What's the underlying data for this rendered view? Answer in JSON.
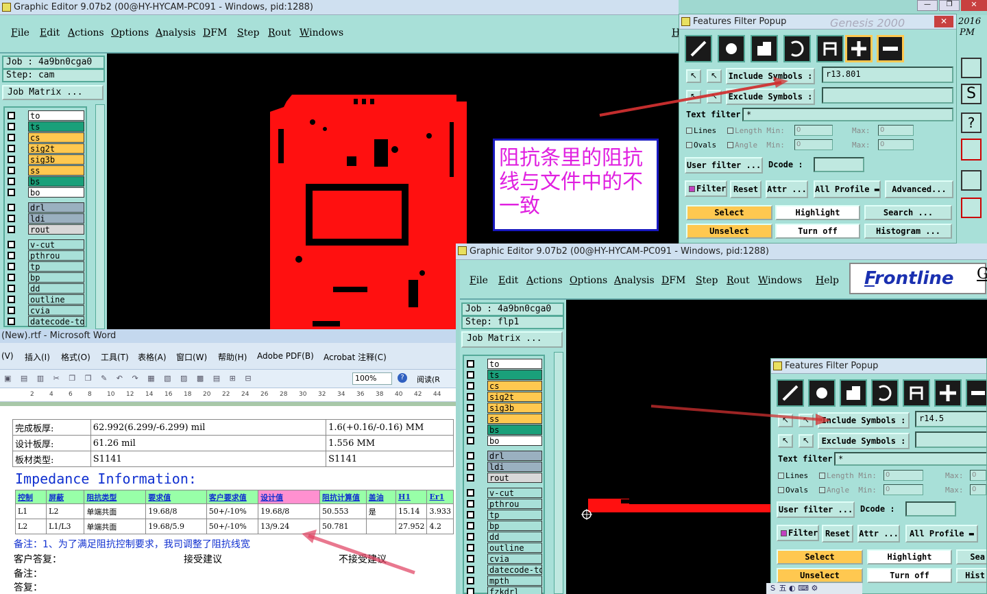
{
  "win1": {
    "title": "Graphic Editor 9.07b2 (00@HY-HYCAM-PC091 - Windows, pid:1288)",
    "menu": [
      "File",
      "Edit",
      "Actions",
      "Options",
      "Analysis",
      "DFM",
      "Step",
      "Rout",
      "Windows"
    ],
    "menu_help_stub": "H",
    "job": "Job : 4a9bn0cga0",
    "step": "Step: cam",
    "job_matrix": "Job Matrix ...",
    "layers": [
      {
        "name": "to",
        "color": "#ffffff"
      },
      {
        "name": "ts",
        "color": "#1aa07a"
      },
      {
        "name": "cs",
        "color": "#ffc850"
      },
      {
        "name": "sig2t",
        "color": "#ffc850"
      },
      {
        "name": "sig3b",
        "color": "#ffc850"
      },
      {
        "name": "ss",
        "color": "#ffc850"
      },
      {
        "name": "bs",
        "color": "#1aa07a"
      },
      {
        "name": "bo",
        "color": "#ffffff"
      },
      {
        "name": "drl",
        "color": "#9ab0c0"
      },
      {
        "name": "ldi",
        "color": "#9ab0c0"
      },
      {
        "name": "rout",
        "color": "#d8d8d8"
      },
      {
        "name": "v-cut",
        "color": "#a8e0d8"
      },
      {
        "name": "pthrou",
        "color": "#a8e0d8"
      },
      {
        "name": "tp",
        "color": "#a8e0d8"
      },
      {
        "name": "bp",
        "color": "#a8e0d8"
      },
      {
        "name": "dd",
        "color": "#a8e0d8"
      },
      {
        "name": "outline",
        "color": "#a8e0d8"
      },
      {
        "name": "cvia",
        "color": "#a8e0d8"
      },
      {
        "name": "datecode-to",
        "color": "#a8e0d8"
      }
    ],
    "annotation": "阻抗条里的阻抗线与文件中的不一致",
    "side_text": [
      "2016",
      "PM"
    ]
  },
  "popup1": {
    "title": "Features Filter Popup",
    "watermark": "Genesis 2000",
    "include_label": "Include Symbols :",
    "include_value": "r13.801",
    "exclude_label": "Exclude Symbols :",
    "exclude_value": "",
    "text_filter_label": "Text filter",
    "text_filter_value": "*",
    "lines": "Lines",
    "ovals": "Ovals",
    "length": "Length",
    "angle": "Angle",
    "min": "Min:",
    "max": "Max:",
    "zero": "0",
    "user_filter": "User filter ...",
    "dcode": "Dcode :",
    "filter": "Filter",
    "reset": "Reset",
    "attr": "Attr ...",
    "all_profile": "All Profile",
    "advanced": "Advanced...",
    "select": "Select",
    "highlight": "Highlight",
    "search": "Search ...",
    "unselect": "Unselect",
    "turn_off": "Turn off",
    "histogram": "Histogram ..."
  },
  "word": {
    "title": "(New).rtf - Microsoft Word",
    "menu": [
      "(V)",
      "插入(I)",
      "格式(O)",
      "工具(T)",
      "表格(A)",
      "窗口(W)",
      "帮助(H)",
      "Adobe PDF(B)",
      "Acrobat 注释(C)"
    ],
    "zoom": "100%",
    "read": "阅读(R",
    "ruler": [
      "2",
      "4",
      "6",
      "8",
      "10",
      "12",
      "14",
      "16",
      "18",
      "20",
      "22",
      "24",
      "26",
      "28",
      "30",
      "32",
      "34",
      "36",
      "38",
      "40",
      "42",
      "44"
    ],
    "info_rows": [
      [
        "完成板厚:",
        "62.992(6.299/-6.299) mil",
        "1.6(+0.16/-0.16) MM"
      ],
      [
        "设计板厚:",
        "61.26 mil",
        "1.556 MM"
      ],
      [
        "板材类型:",
        "S1141",
        "S1141"
      ]
    ],
    "impedance_title": "Impedance Information:",
    "imp_headers": [
      "控制",
      "屏蔽",
      "阻抗类型",
      "要求值",
      "客户要求值",
      "设计值",
      "阻抗计算值",
      "盖油",
      "H1",
      "Er1"
    ],
    "imp_rows": [
      [
        "L1",
        "L2",
        "单端共面",
        "19.68/8",
        "50+/-10%",
        "19.68/8",
        "50.553",
        "是",
        "15.14",
        "3.933"
      ],
      [
        "L2",
        "L1/L3",
        "单端共面",
        "19.68/5.9",
        "50+/-10%",
        "13/9.24",
        "50.781",
        "",
        "27.952",
        "4.2"
      ]
    ],
    "note": "备注：1、为了满足阻抗控制要求，我司调整了阻抗线宽",
    "reply": "客户答复：",
    "accept": "接受建议",
    "reject": "不接受建议",
    "note2": "备注：",
    "answer": "答复："
  },
  "win2": {
    "title": "Graphic Editor 9.07b2 (00@HY-HYCAM-PC091 - Windows, pid:1288)",
    "menu": [
      "File",
      "Edit",
      "Actions",
      "Options",
      "Analysis",
      "DFM",
      "Step",
      "Rout",
      "Windows",
      "Help"
    ],
    "brand": "Frontline",
    "brand_tail": "Ge",
    "job": "Job : 4a9bn0cga0",
    "step": "Step: flp1",
    "job_matrix": "Job Matrix ...",
    "layers": [
      {
        "name": "to",
        "color": "#ffffff"
      },
      {
        "name": "ts",
        "color": "#1aa07a"
      },
      {
        "name": "cs",
        "color": "#ffc850"
      },
      {
        "name": "sig2t",
        "color": "#ffc850"
      },
      {
        "name": "sig3b",
        "color": "#ffc850"
      },
      {
        "name": "ss",
        "color": "#ffc850"
      },
      {
        "name": "bs",
        "color": "#1aa07a"
      },
      {
        "name": "bo",
        "color": "#ffffff"
      },
      {
        "name": "drl",
        "color": "#9ab0c0"
      },
      {
        "name": "ldi",
        "color": "#9ab0c0"
      },
      {
        "name": "rout",
        "color": "#d8d8d8"
      },
      {
        "name": "v-cut",
        "color": "#a8e0d8"
      },
      {
        "name": "pthrou",
        "color": "#a8e0d8"
      },
      {
        "name": "tp",
        "color": "#a8e0d8"
      },
      {
        "name": "bp",
        "color": "#a8e0d8"
      },
      {
        "name": "dd",
        "color": "#a8e0d8"
      },
      {
        "name": "outline",
        "color": "#a8e0d8"
      },
      {
        "name": "cvia",
        "color": "#a8e0d8"
      },
      {
        "name": "datecode-to",
        "color": "#a8e0d8"
      },
      {
        "name": "mpth",
        "color": "#a8e0d8"
      },
      {
        "name": "fzkdrl",
        "color": "#a8e0d8"
      }
    ]
  },
  "popup2": {
    "title": "Features Filter Popup",
    "include_label": "Include Symbols :",
    "include_value": "r14.5",
    "exclude_label": "Exclude Symbols :",
    "text_filter_label": "Text filter",
    "text_filter_value": "*",
    "lines": "Lines",
    "ovals": "Ovals",
    "length": "Length",
    "angle": "Angle",
    "min": "Min:",
    "max": "Max:",
    "zero": "0",
    "user_filter": "User filter ...",
    "dcode": "Dcode :",
    "filter": "Filter",
    "reset": "Reset",
    "attr": "Attr ...",
    "all_profile": "All Profile",
    "select": "Select",
    "highlight": "Highlight",
    "sea": "Sea",
    "unselect": "Unselect",
    "turn_off": "Turn off",
    "hist": "Hist"
  },
  "colors": {
    "accent_red": "#ff1010",
    "panel": "#a8e0d8",
    "yellow_btn": "#ffc850",
    "teal_layer": "#1aa07a"
  }
}
